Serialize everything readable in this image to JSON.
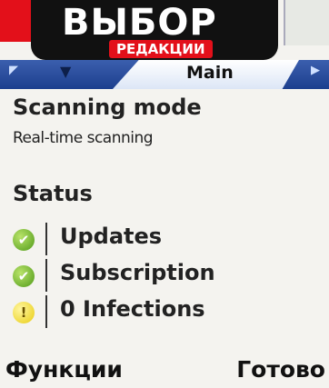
{
  "overlay": {
    "badge_title": "ВЫБОР",
    "badge_subtitle": "РЕДАКЦИИ"
  },
  "tabbar": {
    "active_tab": "Main",
    "left_arrow": "◤",
    "right_arrow": "▶",
    "chevron": "▼"
  },
  "scanning": {
    "title": "Scanning mode",
    "value": "Real-time scanning"
  },
  "status": {
    "title": "Status",
    "items": [
      {
        "label": "Updates",
        "icon": "check-icon",
        "glyph": "✔",
        "state": "ok"
      },
      {
        "label": "Subscription",
        "icon": "check-icon",
        "glyph": "✔",
        "state": "ok"
      },
      {
        "label": "0 Infections",
        "icon": "warning-icon",
        "glyph": "!",
        "state": "warning"
      }
    ]
  },
  "softkeys": {
    "left": "Функции",
    "right": "Готово"
  },
  "colors": {
    "tabbar": "#1c3f8e",
    "ok": "#4f9a18",
    "warning": "#e8cc10",
    "badge_red": "#e3101a"
  }
}
